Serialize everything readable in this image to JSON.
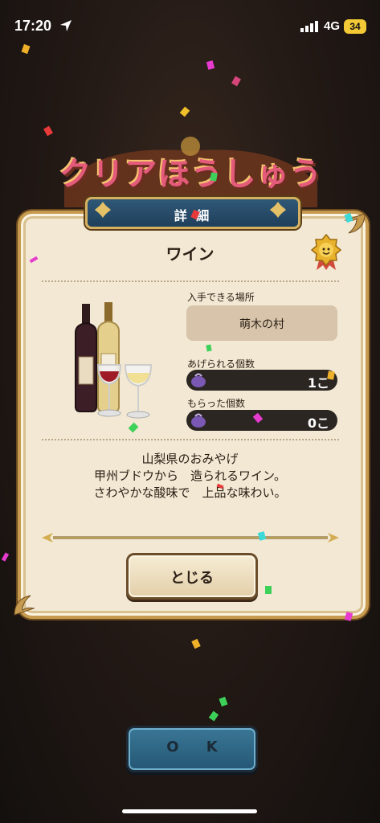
{
  "status_bar": {
    "time": "17:20",
    "network": "4G",
    "battery": "34"
  },
  "banner": {
    "title": "クリアほうしゅう"
  },
  "panel": {
    "header": "詳 細",
    "item_name": "ワイン",
    "acquire_label": "入手できる場所",
    "acquire_place": "萌木の村",
    "give_label": "あげられる個数",
    "give_count": "1こ",
    "received_label": "もらった個数",
    "received_count": "0こ",
    "description": [
      "山梨県のおみやげ",
      "甲州ブドウから　造られるワイン。",
      "さわやかな酸味で　上品な味わい。"
    ],
    "close_button": "とじる"
  },
  "ok_button": "O K",
  "colors": {
    "panel_bg": "#f2e8d3",
    "header_blue": "#2f5877",
    "gold": "#c69a4f",
    "ok_blue": "#2f6a8a"
  },
  "icons": [
    "location-arrow-icon",
    "signal-icon",
    "medal-icon",
    "grape-bag-icon",
    "fleur-icon"
  ]
}
